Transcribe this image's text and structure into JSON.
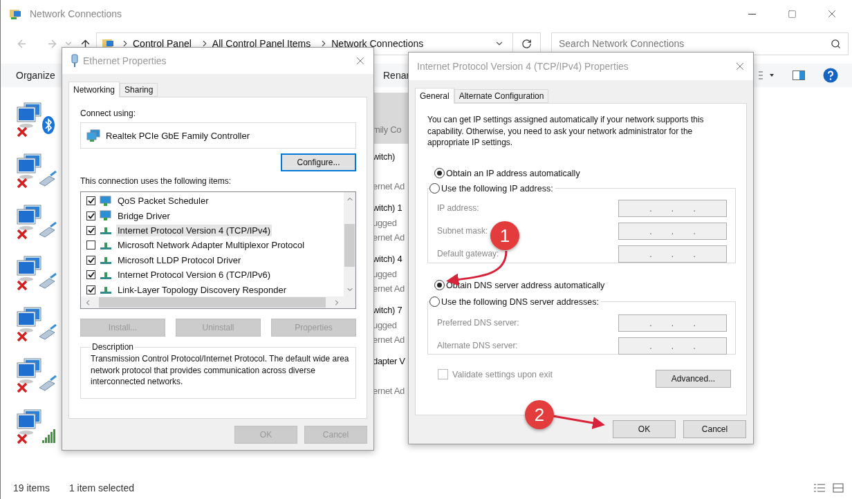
{
  "explorer": {
    "title": "Network Connections",
    "breadcrumb": [
      "Control Panel",
      "All Control Panel Items",
      "Network Connections"
    ],
    "search": {
      "placeholder": "Search Network Connections"
    },
    "commands": [
      "Organize",
      "Renar"
    ],
    "connections": [
      {
        "kind": "bluetooth"
      },
      {
        "kind": "ethernet"
      },
      {
        "kind": "ethernet"
      },
      {
        "kind": "ethernet"
      },
      {
        "kind": "ethernet"
      },
      {
        "kind": "ethernet"
      },
      {
        "kind": "wifi"
      }
    ],
    "tiles": [
      {
        "selected": true,
        "device": "mily Co"
      },
      {
        "selected": false,
        "name": "witch)",
        "device": "ernet Ad"
      },
      {
        "selected": false,
        "name": "witch) 1",
        "status": "ugged",
        "device": "ernet Ad"
      },
      {
        "selected": false,
        "name": "witch) 4",
        "status": "ugged",
        "device": "ernet Ad"
      },
      {
        "selected": false,
        "name": "witch) 7",
        "status": "ugged",
        "device": "ernet Ad"
      },
      {
        "selected": false,
        "name": "dapter V",
        "device": "ernet Ad"
      }
    ],
    "status_bar": {
      "count": "19 items",
      "selection": "1 item selected"
    }
  },
  "ethernet_dialog": {
    "title": "Ethernet Properties",
    "tabs": [
      {
        "label": "Networking",
        "selected": true
      },
      {
        "label": "Sharing",
        "selected": false
      }
    ],
    "connect_using_label": "Connect using:",
    "adapter": "Realtek PCIe GbE Family Controller",
    "configure_button": "Configure...",
    "items_label": "This connection uses the following items:",
    "items": [
      {
        "label": "QoS Packet Scheduler",
        "checked": true,
        "selected": false,
        "kind": "service"
      },
      {
        "label": "Bridge Driver",
        "checked": true,
        "selected": false,
        "kind": "service"
      },
      {
        "label": "Internet Protocol Version 4 (TCP/IPv4)",
        "checked": true,
        "selected": true,
        "kind": "protocol"
      },
      {
        "label": "Microsoft Network Adapter Multiplexor Protocol",
        "checked": false,
        "selected": false,
        "kind": "protocol"
      },
      {
        "label": "Microsoft LLDP Protocol Driver",
        "checked": true,
        "selected": false,
        "kind": "protocol"
      },
      {
        "label": "Internet Protocol Version 6 (TCP/IPv6)",
        "checked": true,
        "selected": false,
        "kind": "protocol"
      },
      {
        "label": "Link-Layer Topology Discovery Responder",
        "checked": true,
        "selected": false,
        "kind": "protocol"
      }
    ],
    "buttons": [
      {
        "label": "Install...",
        "disabled": true
      },
      {
        "label": "Uninstall",
        "disabled": true
      },
      {
        "label": "Properties",
        "disabled": true
      }
    ],
    "description": {
      "title": "Description",
      "text": "Transmission Control Protocol/Internet Protocol. The default wide area network protocol that provides communication across diverse interconnected networks."
    },
    "footer_buttons": [
      {
        "label": "OK",
        "disabled": true
      },
      {
        "label": "Cancel",
        "disabled": true
      }
    ]
  },
  "ipv4_dialog": {
    "title": "Internet Protocol Version 4 (TCP/IPv4) Properties",
    "tabs": [
      {
        "label": "General",
        "selected": true
      },
      {
        "label": "Alternate Configuration",
        "selected": false
      }
    ],
    "intro": "You can get IP settings assigned automatically if your network supports this capability. Otherwise, you need to ask your network administrator for the appropriate IP settings.",
    "ip_mode": [
      {
        "label": "Obtain an IP address automatically",
        "selected": true
      },
      {
        "label": "Use the following IP address:",
        "selected": false
      }
    ],
    "ip_fields": [
      {
        "label": "IP address:",
        "dots": [
          ".",
          ".",
          "."
        ]
      },
      {
        "label": "Subnet mask:",
        "dots": [
          ".",
          ".",
          "."
        ]
      },
      {
        "label": "Default gateway:",
        "dots": [
          ".",
          ".",
          "."
        ]
      }
    ],
    "dns_mode": [
      {
        "label": "Obtain DNS server address automatically",
        "selected": true
      },
      {
        "label": "Use the following DNS server addresses:",
        "selected": false
      }
    ],
    "dns_fields": [
      {
        "label": "Preferred DNS server:",
        "dots": [
          ".",
          ".",
          "."
        ]
      },
      {
        "label": "Alternate DNS server:",
        "dots": [
          ".",
          ".",
          "."
        ]
      }
    ],
    "validate": {
      "label": "Validate settings upon exit",
      "checked": false,
      "disabled": true
    },
    "advanced_button": "Advanced...",
    "footer_buttons": [
      {
        "label": "OK",
        "disabled": false
      },
      {
        "label": "Cancel",
        "disabled": false
      }
    ]
  },
  "annotations": [
    {
      "label": "1"
    },
    {
      "label": "2"
    }
  ]
}
